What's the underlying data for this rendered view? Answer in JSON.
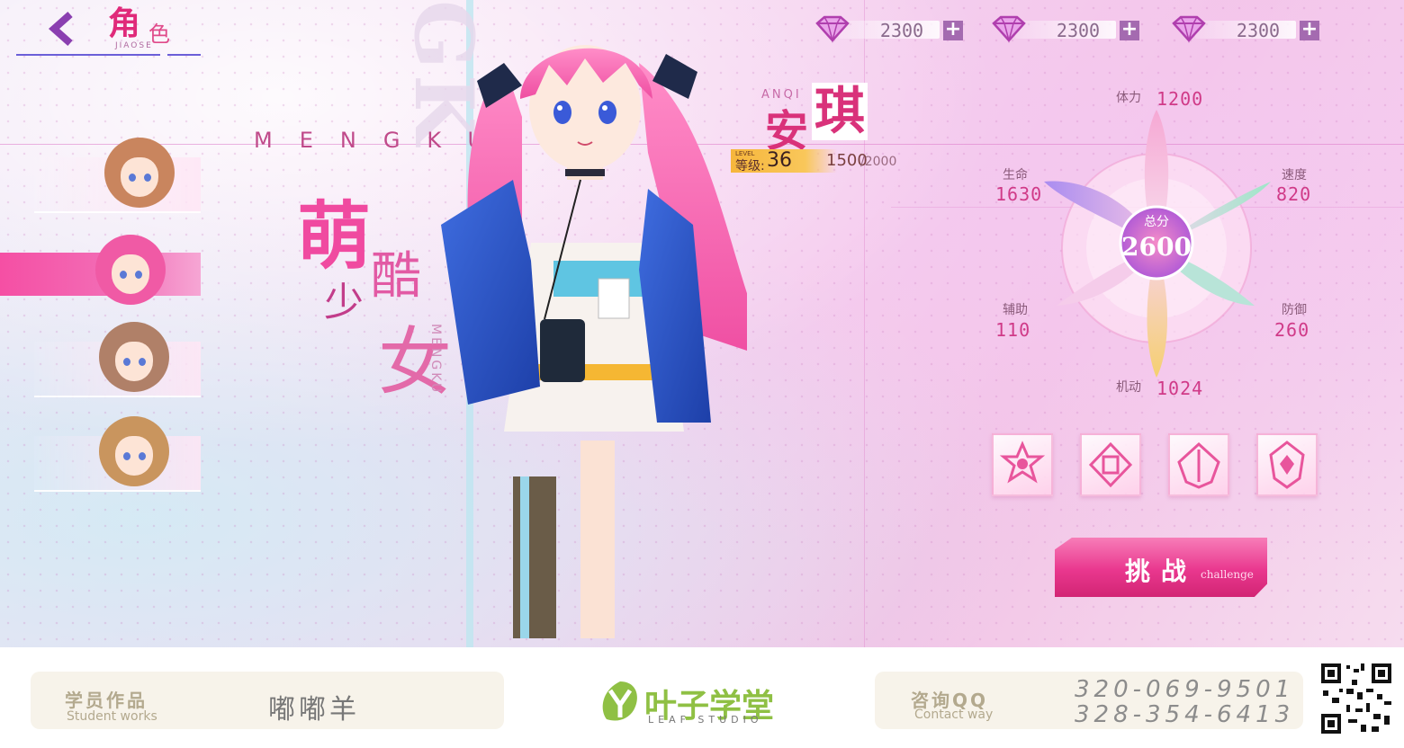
{
  "header": {
    "title_main": "角",
    "title_sub": "色",
    "title_en": "JIAOSE"
  },
  "currencies": [
    {
      "value": "2300",
      "icon": "diamond-gem-icon"
    },
    {
      "value": "2300",
      "icon": "diamond-gem-icon"
    },
    {
      "value": "2300",
      "icon": "diamond-gem-icon"
    }
  ],
  "currency_plus_label": "+",
  "character_list": [
    {
      "hair_color": "#c9855e",
      "active": false
    },
    {
      "hair_color": "#f05aa5",
      "active": true
    },
    {
      "hair_color": "#b08068",
      "active": false
    },
    {
      "hair_color": "#c9955e",
      "active": false
    }
  ],
  "decor": {
    "mengku_en": "MENGKU",
    "meng": "萌",
    "ku": "酷",
    "shao": "少",
    "nv": "女",
    "vertical": "MENGKU",
    "big_letters": "GK"
  },
  "character": {
    "name_en": "ANQI",
    "name_cn_1": "安",
    "name_cn_2": "琪",
    "level_tag": "LEVEL",
    "level_label": "等级:",
    "level": "36",
    "exp_current": "1500",
    "exp_max": "/2000"
  },
  "stats": {
    "stamina": {
      "label": "体力",
      "value": "1200"
    },
    "life": {
      "label": "生命",
      "value": "1630"
    },
    "speed": {
      "label": "速度",
      "value": "820"
    },
    "assist": {
      "label": "辅助",
      "value": "110"
    },
    "defense": {
      "label": "防御",
      "value": "260"
    },
    "mobility": {
      "label": "机动",
      "value": "1024"
    },
    "total_label": "总分",
    "total_value": "2600"
  },
  "skills": [
    "star-skill-icon",
    "cube-skill-icon",
    "arrow-skill-icon",
    "crest-skill-icon"
  ],
  "challenge": {
    "label": "挑战",
    "sub": "challenge"
  },
  "footer": {
    "student_title": "学员作品",
    "student_sub": "Student works",
    "student_name": "嘟嘟羊",
    "logo_cn": "叶子学堂",
    "logo_en": "LEAF STUDIO",
    "contact_title": "咨询QQ",
    "contact_sub": "Contact way",
    "qq_1": "320-069-9501",
    "qq_2": "328-354-6413"
  },
  "colors": {
    "accent": "#e9378e",
    "level_bar": "#f6b63c",
    "logo": "#8fc044"
  }
}
